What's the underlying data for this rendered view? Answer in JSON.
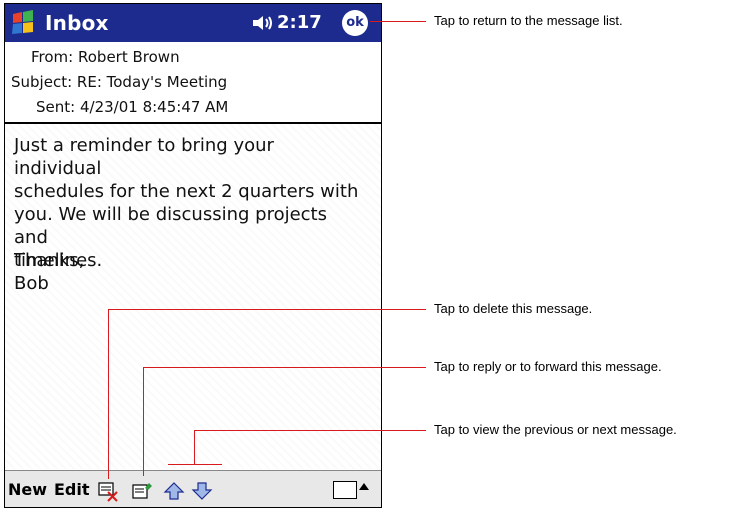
{
  "titlebar": {
    "title": "Inbox",
    "time": "2:17",
    "ok_label": "ok"
  },
  "header": {
    "from_label": "From:",
    "from_value": "Robert Brown",
    "subject_label": "Subject:",
    "subject_value": "RE: Today's Meeting",
    "sent_label": "Sent:",
    "sent_value": "4/23/01 8:45:47 AM"
  },
  "message": {
    "body_lines": [
      "Just a reminder to bring your individual",
      "schedules for the next 2 quarters with",
      "you. We will be discussing projects and",
      "timelines."
    ],
    "closing": "Thanks,",
    "signature": "Bob"
  },
  "toolbar": {
    "new_label": "New",
    "edit_label": "Edit"
  },
  "callouts": {
    "ok": "Tap to return to the message list.",
    "delete": "Tap to delete this message.",
    "reply": "Tap to reply or to forward this message.",
    "navigate": "Tap to view the previous or next message."
  },
  "colors": {
    "titlebar": "#1d2b8f",
    "callout_line": "#d91a1a"
  }
}
